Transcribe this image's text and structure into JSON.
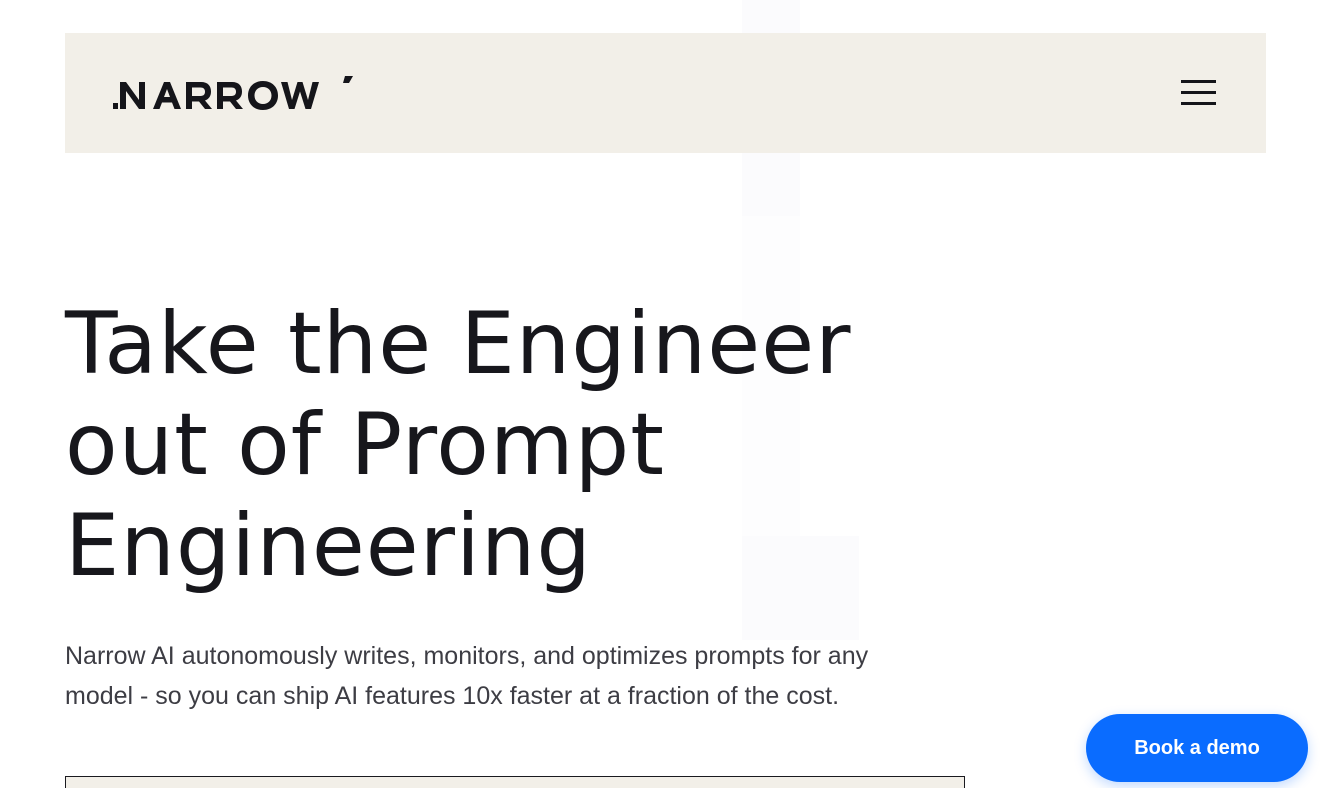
{
  "header": {
    "logo_text": "NARROW",
    "menu_icon": "hamburger-menu-icon"
  },
  "hero": {
    "title_lines": [
      "Take the Engineer",
      "out of Prompt",
      "Engineering"
    ],
    "subtitle_lines": [
      "Narrow AI autonomously writes, monitors, and optimizes prompts for any",
      "model - so you can ship AI features 10x faster at a fraction of the cost."
    ]
  },
  "cta": {
    "demo_label": "Book a demo"
  },
  "colors": {
    "header_bg": "#f2efe8",
    "text": "#17171c",
    "subtitle": "#3d3d44",
    "accent": "#0a6cff"
  }
}
